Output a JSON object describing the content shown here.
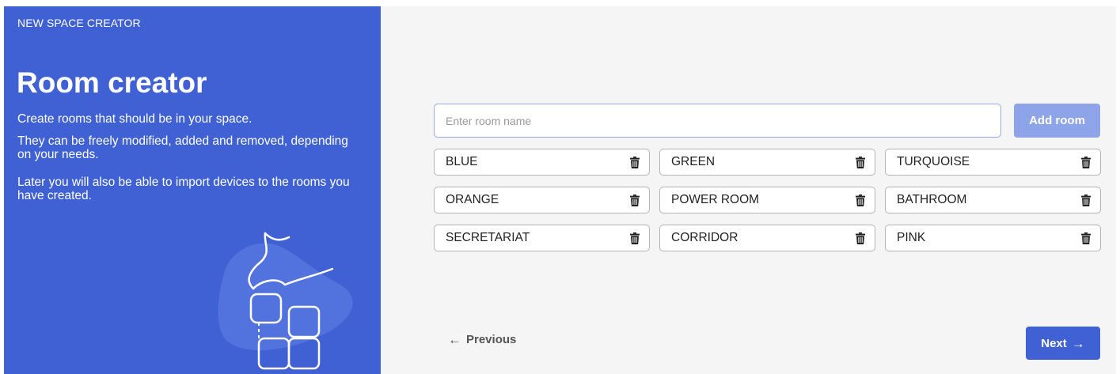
{
  "app": {
    "title": "NEW SPACE CREATOR"
  },
  "intro": {
    "heading": "Room creator",
    "line1": "Create rooms that should be in your space.",
    "line2": "They can be freely modified, added and removed, depending on your needs.",
    "line3": "Later you will also be able to import devices to the rooms you have created."
  },
  "form": {
    "placeholder": "Enter room name",
    "value": "",
    "add_label": "Add room"
  },
  "rooms": [
    {
      "name": "BLUE",
      "icon": "trash-icon"
    },
    {
      "name": "GREEN",
      "icon": "trash-icon"
    },
    {
      "name": "TURQUOISE",
      "icon": "trash-icon"
    },
    {
      "name": "ORANGE",
      "icon": "trash-icon"
    },
    {
      "name": "POWER ROOM",
      "icon": "trash-icon"
    },
    {
      "name": "BATHROOM",
      "icon": "trash-icon"
    },
    {
      "name": "SECRETARIAT",
      "icon": "trash-icon"
    },
    {
      "name": "CORRIDOR",
      "icon": "trash-icon"
    },
    {
      "name": "PINK",
      "icon": "trash-icon"
    }
  ],
  "nav": {
    "previous_label": "Previous",
    "previous_icon": "arrow-left-icon",
    "next_label": "Next",
    "next_icon": "arrow-right-icon"
  },
  "colors": {
    "primary": "#3f61d4",
    "primary_disabled": "#8ea4e8",
    "background": "#f5f5f5"
  }
}
